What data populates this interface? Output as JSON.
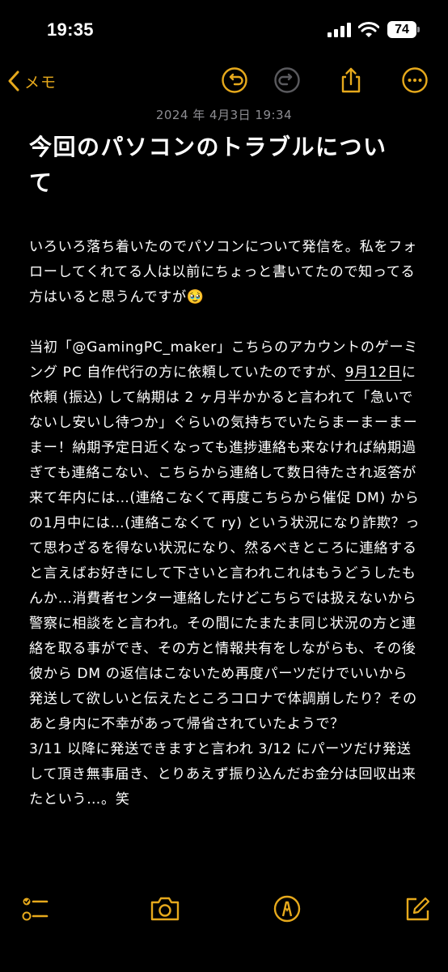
{
  "status_bar": {
    "time": "19:35",
    "battery_level": "74",
    "icons": [
      "cellular-signal-icon",
      "wifi-icon",
      "battery-icon"
    ]
  },
  "nav": {
    "back_label": "メモ",
    "icons": [
      "chevron-left-icon",
      "undo-icon",
      "redo-icon",
      "share-icon",
      "more-icon"
    ],
    "accent_color": "#E6A91C"
  },
  "note": {
    "date": "2024 年 4月3日 19:34",
    "title": "今回のパソコンのトラブルについて",
    "paragraph1": "いろいろ落ち着いたのでパソコンについて発信を。私をフォローしてくれてる人は以前にちょっと書いてたので知ってる方はいると思うんですが🥹",
    "paragraph2_before": "当初「@GamingPC_maker」こちらのアカウントのゲーミング PC 自作代行の方に依頼していたのですが、",
    "paragraph2_link": "9月12日",
    "paragraph2_after": "に依頼 (振込) して納期は 2 ヶ月半かかると言われて「急いでないし安いし待つか」ぐらいの気持ちでいたらまーまーまーまー！納期予定日近くなっても進捗連絡も来なければ納期過ぎても連絡こない、こちらから連絡して数日待たされ返答が来て年内には…(連絡こなくて再度こちらから催促 DM) からの1月中には…(連絡こなくて ry) という状況になり詐欺？って思わざるを得ない状況になり、然るべきところに連絡すると言えばお好きにして下さいと言われこれはもうどうしたもんか…消費者センター連絡したけどこちらでは扱えないから警察に相談をと言われ。その間にたまたま同じ状況の方と連絡を取る事ができ、その方と情報共有をしながらも、その後彼から DM の返信はこないため再度パーツだけでいいから発送して欲しいと伝えたところコロナで体調崩したり？そのあと身内に不幸があって帰省されていたようで？",
    "paragraph3": "3/11 以降に発送できますと言われ 3/12 にパーツだけ発送して頂き無事届き、とりあえず振り込んだお金分は回収出来たという…。笑"
  },
  "toolbar": {
    "icons": [
      "checklist-icon",
      "camera-icon",
      "markup-pen-icon",
      "compose-icon"
    ]
  }
}
